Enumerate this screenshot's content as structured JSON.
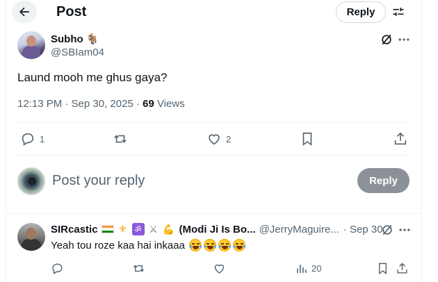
{
  "header": {
    "title": "Post",
    "reply_label": "Reply"
  },
  "post": {
    "author_name": "Subho 🐐",
    "author_handle": "@SBIam04",
    "text": "Laund mooh me ghus gaya?",
    "time": "12:13 PM · Sep 30, 2025 · ",
    "views_count": "69",
    "views_label": " Views",
    "actions": {
      "replies": "1",
      "retweets": "",
      "likes": "2"
    }
  },
  "composer": {
    "placeholder": "Post your reply",
    "reply_label": "Reply"
  },
  "reply": {
    "author_name": "SIRcastic",
    "author_suffix": "(Modi Ji Is Bo...",
    "author_handle": "@JerryMaguire...",
    "date": "· Sep 30",
    "text": "Yeah tou roze kaa hai inkaaa",
    "views": "20"
  },
  "icons": {
    "back": "arrow-left-icon",
    "filter": "sliders-icon",
    "grok": "grok-icon",
    "more": "more-dots-icon",
    "reply": "comment-icon",
    "retweet": "retweet-icon",
    "like": "heart-icon",
    "bookmark": "bookmark-icon",
    "share": "share-icon",
    "views": "analytics-icon"
  },
  "colors": {
    "text_primary": "#0f1419",
    "text_secondary": "#536471",
    "border": "#eff3f4",
    "reply_button_disabled": "#8b9196"
  }
}
